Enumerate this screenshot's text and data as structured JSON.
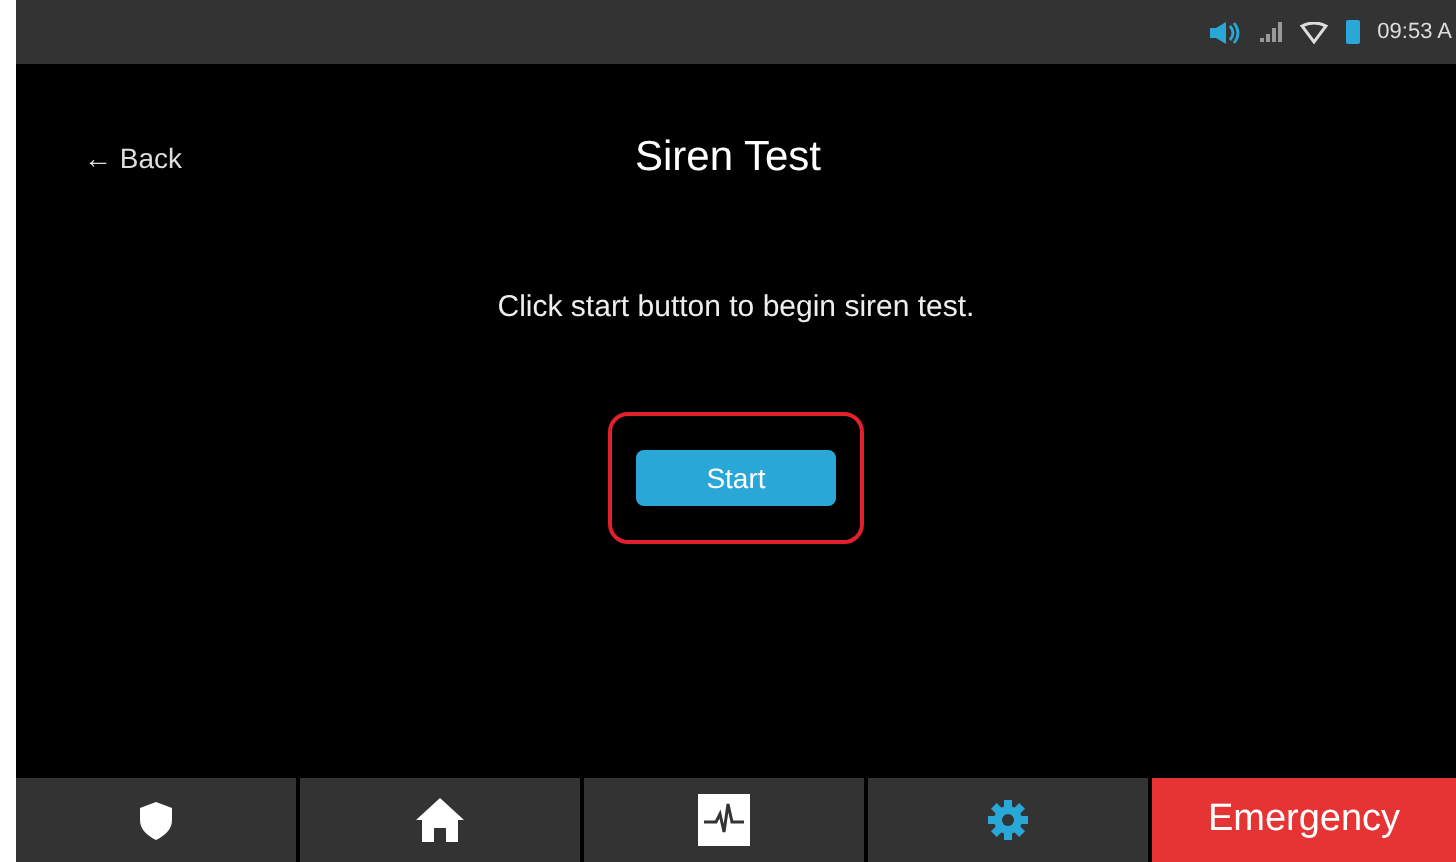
{
  "status_bar": {
    "time": "09:53 A"
  },
  "header": {
    "back": "← Back",
    "title": "Siren Test"
  },
  "message": "Click start button to begin siren test.",
  "start_button": {
    "label": "Start",
    "highlighted": true
  },
  "nav": [
    {
      "kind": "shield",
      "selected": false
    },
    {
      "kind": "home",
      "selected": false
    },
    {
      "kind": "pulse",
      "selected": false
    },
    {
      "kind": "gear",
      "selected": true
    },
    {
      "kind": "emergency",
      "label": "Emergency"
    }
  ]
}
